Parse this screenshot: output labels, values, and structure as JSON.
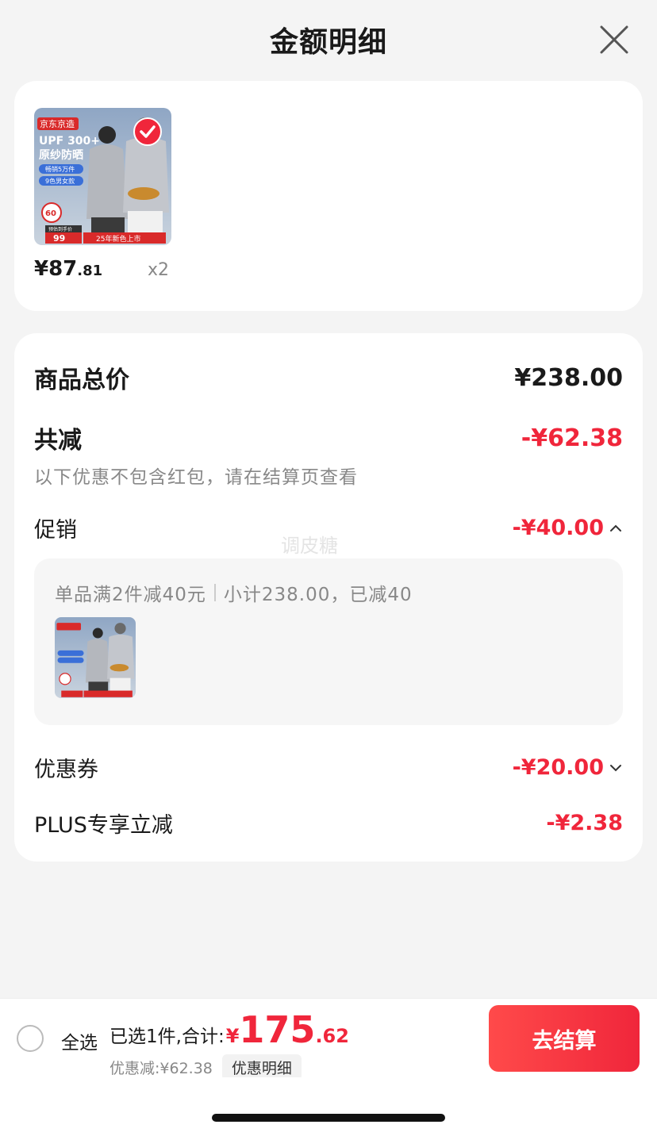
{
  "header": {
    "title": "金额明细"
  },
  "product": {
    "image_texts": {
      "brand": "京东京造",
      "headline1": "UPF 300+",
      "headline2": "原纱防晒",
      "tag1": "畅销5万件",
      "tag2": "9色男女款",
      "badge": "60",
      "price_label": "预估到手价",
      "price": "99",
      "banner": "25年新色上市"
    },
    "price_int": "¥87",
    "price_dec": ".81",
    "quantity": "x2"
  },
  "detail": {
    "goods_total_label": "商品总价",
    "goods_total_value": "¥238.00",
    "reduced_label": "共减",
    "reduced_value": "-¥62.38",
    "note": "以下优惠不包含红包，请在结算页查看",
    "promo_label": "促销",
    "promo_value": "-¥40.00",
    "promo_rule": "单品满2件减40元",
    "promo_subtotal": "小计238.00，已减40",
    "watermark": "调皮糖",
    "coupon_label": "优惠券",
    "coupon_value": "-¥20.00",
    "plus_label": "PLUS专享立减",
    "plus_value": "-¥2.38"
  },
  "bottom": {
    "select_all": "全选",
    "selected_text": "已选1件,合计:",
    "total_yen": "¥",
    "total_int": "175",
    "total_dec": ".62",
    "discount_text": "优惠减:¥62.38",
    "detail_chip": "优惠明细",
    "checkout": "去结算"
  },
  "colors": {
    "accent": "#f0263b",
    "background": "#f4f4f4"
  }
}
